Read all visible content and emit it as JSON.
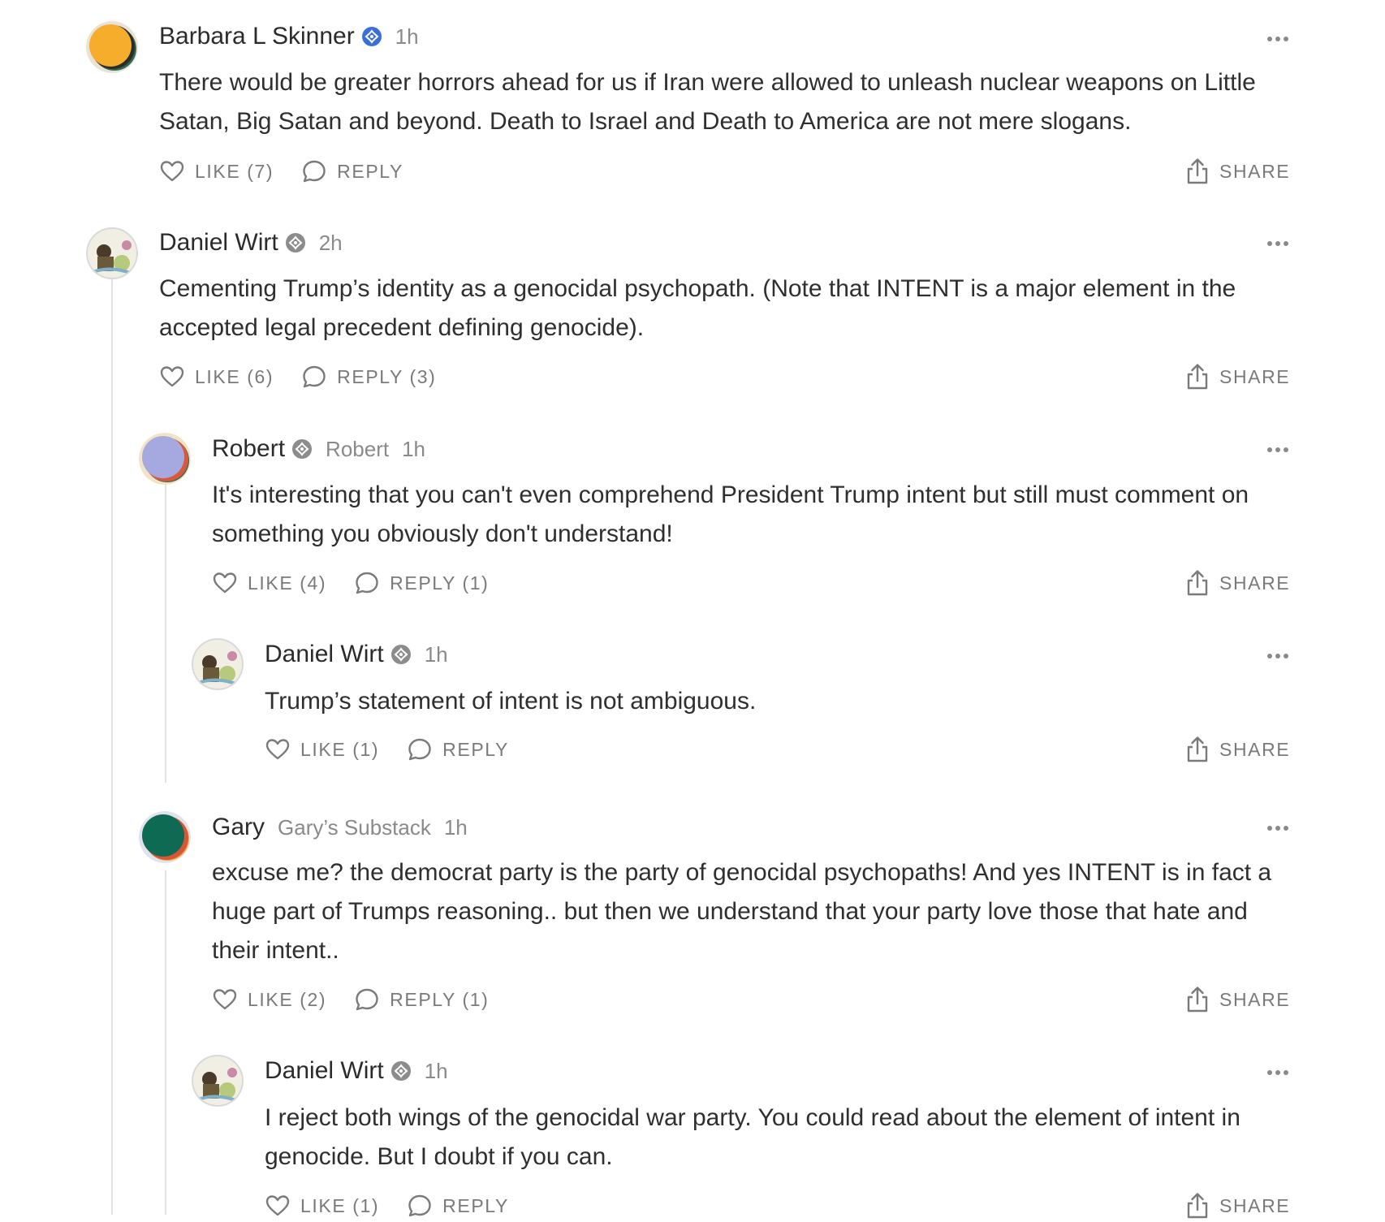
{
  "comments": [
    {
      "author": "Barbara L Skinner",
      "publication": "",
      "time": "1h",
      "badge_color": "#3b6fd8",
      "avatar_icon": "orange-circle-avatar",
      "text": "There would be greater horrors ahead for us if Iran were allowed to unleash nuclear weapons on Little Satan, Big Satan and beyond. Death to Israel and Death to America are not mere slogans.",
      "like_label": "LIKE (7)",
      "reply_label": "REPLY",
      "share_label": "SHARE"
    },
    {
      "author": "Daniel Wirt",
      "publication": "",
      "time": "2h",
      "badge_color": "#8c8c8c",
      "avatar_icon": "photo-avatar",
      "text": "Cementing Trump’s identity as a genocidal psychopath. (Note that INTENT is a major element in the accepted legal precedent defining genocide).",
      "like_label": "LIKE (6)",
      "reply_label": "REPLY (3)",
      "share_label": "SHARE"
    },
    {
      "author": "Robert",
      "publication": "Robert",
      "time": "1h",
      "badge_color": "#8c8c8c",
      "avatar_icon": "lavender-circle-avatar",
      "text": "It's interesting that you can't even comprehend President Trump intent but still must comment on something you obviously don't understand!",
      "like_label": "LIKE (4)",
      "reply_label": "REPLY (1)",
      "share_label": "SHARE"
    },
    {
      "author": "Daniel Wirt",
      "publication": "",
      "time": "1h",
      "badge_color": "#8c8c8c",
      "avatar_icon": "photo-avatar",
      "text": "Trump’s statement of intent is not ambiguous.",
      "like_label": "LIKE (1)",
      "reply_label": "REPLY",
      "share_label": "SHARE"
    },
    {
      "author": "Gary",
      "publication": "Gary’s Substack",
      "time": "1h",
      "badge_color": "",
      "avatar_icon": "green-circle-avatar",
      "text": "excuse me? the democrat party is the party of genocidal psychopaths! And yes INTENT is in fact a huge part of Trumps reasoning.. but then we understand that your party love those that hate and their intent..",
      "like_label": "LIKE (2)",
      "reply_label": "REPLY (1)",
      "share_label": "SHARE"
    },
    {
      "author": "Daniel Wirt",
      "publication": "",
      "time": "1h",
      "badge_color": "#8c8c8c",
      "avatar_icon": "photo-avatar",
      "text": "I reject both wings of the genocidal war party. You could read about the element of intent in genocide. But I doubt if you can.",
      "like_label": "LIKE (1)",
      "reply_label": "REPLY",
      "share_label": "SHARE"
    }
  ],
  "colors": {
    "text": "#2f2f2f",
    "muted": "#8a8a8a",
    "thread_line": "#e3e3e3",
    "verified_blue": "#3b6fd8"
  }
}
